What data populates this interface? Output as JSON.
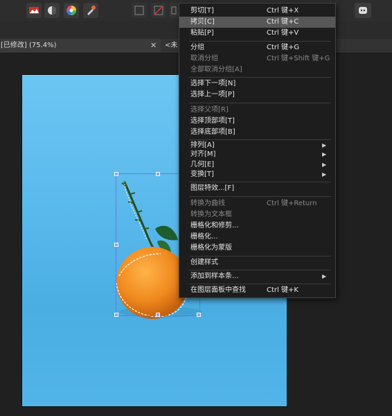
{
  "tabs": [
    {
      "label": "[已修改] (75.4%)",
      "active": true
    },
    {
      "label": "<未标",
      "active": false
    }
  ],
  "toolbar": {
    "persona_icons": [
      "photo-persona-icon",
      "pixel-persona-icon",
      "color-wheel-icon",
      "export-persona-icon"
    ],
    "assistant_icon": "assistant-icon"
  },
  "context_menu": {
    "items": [
      {
        "label": "剪切[T]",
        "shortcut": "Ctrl 键+X",
        "disabled": false,
        "submenu": false,
        "highlighted": false
      },
      {
        "label": "拷贝[C]",
        "shortcut": "Ctrl 键+C",
        "disabled": false,
        "submenu": false,
        "highlighted": true
      },
      {
        "label": "粘贴[P]",
        "shortcut": "Ctrl 键+V",
        "disabled": false,
        "submenu": false,
        "highlighted": false
      },
      {
        "label": "分组",
        "shortcut": "Ctrl 键+G",
        "disabled": false,
        "submenu": false,
        "highlighted": false
      },
      {
        "label": "取消分组",
        "shortcut": "Ctrl 键+Shift 键+G",
        "disabled": true,
        "submenu": false,
        "highlighted": false
      },
      {
        "label": "全部取消分组[A]",
        "shortcut": "",
        "disabled": true,
        "submenu": false,
        "highlighted": false
      },
      {
        "label": "选择下一项[N]",
        "shortcut": "",
        "disabled": false,
        "submenu": false,
        "highlighted": false
      },
      {
        "label": "选择上一项[P]",
        "shortcut": "",
        "disabled": false,
        "submenu": false,
        "highlighted": false
      },
      {
        "label": "选择父项[R]",
        "shortcut": "",
        "disabled": true,
        "submenu": false,
        "highlighted": false
      },
      {
        "label": "选择顶部项[T]",
        "shortcut": "",
        "disabled": false,
        "submenu": false,
        "highlighted": false
      },
      {
        "label": "选择底部项[B]",
        "shortcut": "",
        "disabled": false,
        "submenu": false,
        "highlighted": false
      },
      {
        "label": "排列[A]",
        "shortcut": "",
        "disabled": false,
        "submenu": true,
        "highlighted": false
      },
      {
        "label": "对齐[M]",
        "shortcut": "",
        "disabled": false,
        "submenu": true,
        "highlighted": false
      },
      {
        "label": "几何[E]",
        "shortcut": "",
        "disabled": false,
        "submenu": true,
        "highlighted": false
      },
      {
        "label": "变换[T]",
        "shortcut": "",
        "disabled": false,
        "submenu": true,
        "highlighted": false
      },
      {
        "label": "图层特效...[F]",
        "shortcut": "",
        "disabled": false,
        "submenu": false,
        "highlighted": false
      },
      {
        "label": "转换为曲线",
        "shortcut": "Ctrl 键+Return",
        "disabled": true,
        "submenu": false,
        "highlighted": false
      },
      {
        "label": "转换为文本框",
        "shortcut": "",
        "disabled": true,
        "submenu": false,
        "highlighted": false
      },
      {
        "label": "栅格化和修剪...",
        "shortcut": "",
        "disabled": false,
        "submenu": false,
        "highlighted": false
      },
      {
        "label": "栅格化...",
        "shortcut": "",
        "disabled": false,
        "submenu": false,
        "highlighted": false
      },
      {
        "label": "栅格化为蒙版",
        "shortcut": "",
        "disabled": false,
        "submenu": false,
        "highlighted": false
      },
      {
        "label": "创建样式",
        "shortcut": "",
        "disabled": false,
        "submenu": false,
        "highlighted": false
      },
      {
        "label": "添加到样本条...",
        "shortcut": "",
        "disabled": false,
        "submenu": true,
        "highlighted": false
      },
      {
        "label": "在图层面板中查找",
        "shortcut": "Ctrl 键+K",
        "disabled": false,
        "submenu": false,
        "highlighted": false
      }
    ]
  },
  "colors": {
    "canvas_blue": "#52b4e8",
    "menu_bg": "#1d1d1d",
    "menu_highlight": "#575757",
    "selection_box": "#6a7bd8",
    "orange": "#f08a1f"
  }
}
